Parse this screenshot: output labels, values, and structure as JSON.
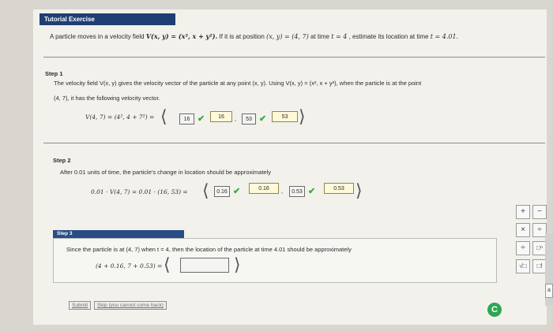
{
  "header": {
    "title": "Tutorial Exercise"
  },
  "problem": {
    "text_a": "A particle moves in a velocity field ",
    "field": "V(x, y) = (x², x + y²).",
    "text_b": " If it is at position ",
    "pos": "(x, y) = (4, 7)",
    "text_c": " at time ",
    "time": "t = 4",
    "text_d": ", estimate its location at time ",
    "target_time": "t = 4.01."
  },
  "step1": {
    "label": "Step 1",
    "line1": "The velocity field V(x, y) gives the velocity vector of the particle at any point (x, y). Using V(x, y) = (x², x + y²), when the particle is at the point",
    "line2": "(4, 7), it has the following velocity vector.",
    "expr": "V(4, 7) = (4², 4 + 7²) =",
    "answers": [
      "16",
      "16",
      "53",
      "53"
    ],
    "separator": ","
  },
  "step2": {
    "label": "Step 2",
    "line1": "After 0.01 units of time, the particle's change in location should be approximately",
    "expr": "0.01 · V(4, 7) = 0.01 · (16, 53) =",
    "answers": [
      "0.16",
      "0.16",
      "0.53",
      "0.53"
    ],
    "separator": ","
  },
  "step3": {
    "label": "Step 3",
    "line1": "Since the particle is at (4, 7) when t = 4, then the location of the particle at time 4.01 should be approximately",
    "expr": "(4 + 0.16, 7 + 0.53) =",
    "input_value": ""
  },
  "toolbar": {
    "plus": "+",
    "minus": "−",
    "times": "×",
    "divide": "÷",
    "fraction": "÷",
    "power": "□ⁿ",
    "sqrt": "√□",
    "other": "□!",
    "a": "a"
  },
  "actions": {
    "submit": "Submit",
    "skip": "Skip (you cannot come back)"
  },
  "icons": {
    "check": "checkmark-icon",
    "chrome": "chrome-icon"
  }
}
